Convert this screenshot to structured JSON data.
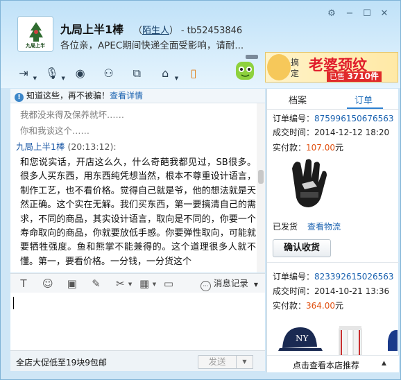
{
  "contact": {
    "name": "九局上半1棒",
    "stranger_label": "陌生人",
    "open_paren": "（",
    "close_paren": "）",
    "id_text": "- tb52453846",
    "signature": "各位亲，APEC期间快递全面受影响，请耐..."
  },
  "avatar": {
    "text": "九局上半"
  },
  "ad": {
    "word1": "搞定",
    "title": "老婆颈纹",
    "sold_prefix": "已售",
    "sold_count": "3710件"
  },
  "notice": {
    "text": "知道这些，再不被骗！",
    "link": "查看详情"
  },
  "chat": {
    "old_messages": [
      "我都没来得及保养就坏……",
      "你和我谈这个……"
    ],
    "sender": "九局上半1棒",
    "time": "(20:13:12):",
    "body": "和您说实话，开店这么久，什么奇葩我都见过，SB很多。很多人买东西，用东西纯凭想当然，根本不尊重设计语言，制作工艺，也不看价格。觉得自己就是爷，他的想法就是天然正确。这个实在无解。我们买东西，第一要搞清自己的需求，不同的商品，其实设计语言，取向是不同的，你要一个寿命取向的商品，你就要放低手感。你要弹性取向，可能就要牺牲强度。鱼和熊掌不能兼得的。这个道理很多人就不懂。第一，要看价格。一分钱，一分货这个"
  },
  "input_toolbar": {
    "history_label": "消息记录"
  },
  "bottom_bar": {
    "promo_text": "全店大促低至19块9包邮",
    "send_label": "发送"
  },
  "right_panel": {
    "tabs": [
      {
        "label": "档案"
      },
      {
        "label": "订单"
      }
    ],
    "orders": [
      {
        "number_label": "订单编号：",
        "number": "875996150676563",
        "time_label": "成交时间：",
        "time": "2014-12-12 18:20",
        "paid_label": "实付款：",
        "paid": "107.00",
        "paid_unit": "元",
        "status": "已发货",
        "logistics_link": "查看物流",
        "confirm_label": "确认收货"
      },
      {
        "number_label": "订单编号：",
        "number": "823392615026563",
        "time_label": "成交时间：",
        "time": "2014-10-21 13:36",
        "paid_label": "实付款：",
        "paid": "364.00",
        "paid_unit": "元"
      }
    ],
    "recommend_label": "点击查看本店推荐"
  },
  "colors": {
    "title_bg": "#cde7f8",
    "link_blue": "#1a62b0",
    "price_orange": "#e05010",
    "ad_red": "#e01c2a"
  }
}
